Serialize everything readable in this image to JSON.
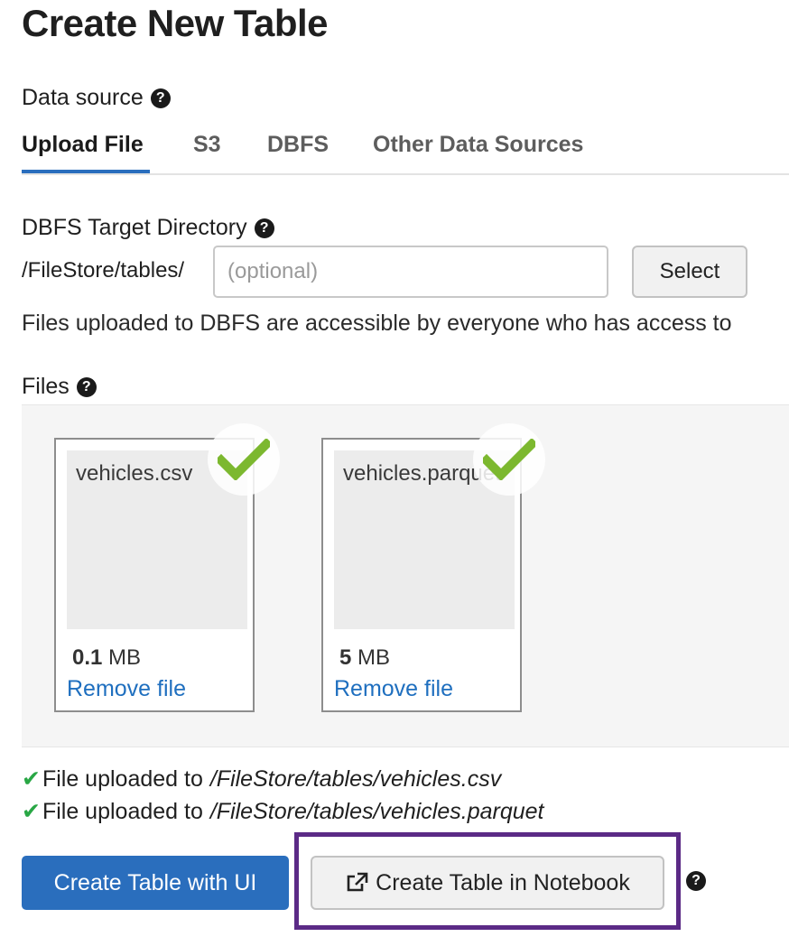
{
  "page": {
    "title": "Create New Table"
  },
  "data_source": {
    "label": "Data source",
    "tabs": [
      {
        "label": "Upload File",
        "active": true
      },
      {
        "label": "S3",
        "active": false
      },
      {
        "label": "DBFS",
        "active": false
      },
      {
        "label": "Other Data Sources",
        "active": false
      }
    ]
  },
  "target": {
    "label": "DBFS Target Directory",
    "prefix": "/FileStore/tables/",
    "placeholder": "(optional)",
    "value": "",
    "select_label": "Select",
    "note": "Files uploaded to DBFS are accessible by everyone who has access to"
  },
  "files": {
    "label": "Files",
    "items": [
      {
        "name": "vehicles.csv",
        "size_value": "0.1",
        "size_unit": "MB",
        "remove_label": "Remove file"
      },
      {
        "name": "vehicles.parquet",
        "size_value": "5",
        "size_unit": "MB",
        "remove_label": "Remove file"
      }
    ]
  },
  "status": [
    {
      "prefix": "File uploaded to",
      "path": "/FileStore/tables/vehicles.csv"
    },
    {
      "prefix": "File uploaded to",
      "path": "/FileStore/tables/vehicles.parquet"
    }
  ],
  "actions": {
    "create_ui_label": "Create Table with UI",
    "create_notebook_label": "Create Table in Notebook"
  },
  "icons": {
    "help": "question-circle-icon",
    "check": "check-icon",
    "external_link": "external-link-icon"
  },
  "colors": {
    "accent": "#2a6ebd",
    "success": "#29a745",
    "check_badge": "#7cb82f",
    "highlight": "#5b2a86",
    "link": "#1f6fbf"
  }
}
